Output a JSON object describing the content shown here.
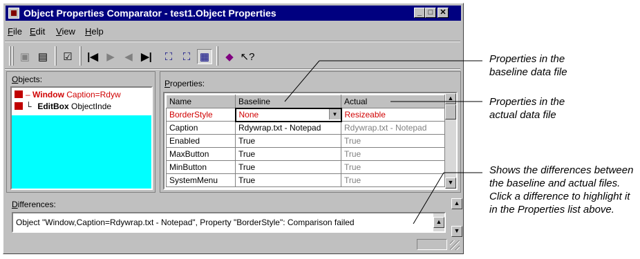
{
  "window": {
    "title": "Object Properties Comparator - test1.Object Properties",
    "controls": [
      "_",
      "□",
      "✕"
    ]
  },
  "menu": [
    {
      "label": "File",
      "accel": "F",
      "rest": "ile"
    },
    {
      "label": "Edit",
      "accel": "E",
      "rest": "dit"
    },
    {
      "label": "View",
      "accel": "V",
      "rest": "iew"
    },
    {
      "label": "Help",
      "accel": "H",
      "rest": "elp"
    }
  ],
  "toolbar": {
    "icons": [
      "save-baseline-icon",
      "save-icon",
      "properties-icon",
      "first-icon",
      "next-icon",
      "previous-icon",
      "last-icon",
      "compare-icon",
      "compare-selected-icon",
      "compare-all-icon",
      "help-book-icon",
      "whats-this-icon"
    ],
    "glyphs": [
      "▣",
      "▤",
      "☑",
      "|◀",
      "▶",
      "◀",
      "▶|",
      "⛶",
      "⛶",
      "▦",
      "◆",
      "↖?"
    ]
  },
  "objects": {
    "label_accel": "O",
    "label_rest": "bjects:",
    "items": [
      {
        "name": "Window",
        "detail": "Caption=Rdyw",
        "prefix": "–",
        "failed": true
      },
      {
        "name": "EditBox",
        "detail": "ObjectInde",
        "prefix": "└",
        "failed": false
      }
    ],
    "fill_color": "#00ffff"
  },
  "properties": {
    "label_accel": "P",
    "label_rest": "roperties:",
    "columns": [
      "Name",
      "Baseline",
      "Actual"
    ],
    "rows": [
      {
        "name": "BorderStyle",
        "baseline": "None",
        "actual": "Resizeable",
        "diff": true
      },
      {
        "name": "Caption",
        "baseline": "Rdywrap.txt - Notepad",
        "actual": "Rdywrap.txt - Notepad",
        "diff": false
      },
      {
        "name": "Enabled",
        "baseline": "True",
        "actual": "True",
        "diff": false
      },
      {
        "name": "MaxButton",
        "baseline": "True",
        "actual": "True",
        "diff": false
      },
      {
        "name": "MinButton",
        "baseline": "True",
        "actual": "True",
        "diff": false
      },
      {
        "name": "SystemMenu",
        "baseline": "True",
        "actual": "True",
        "diff": false
      }
    ]
  },
  "differences": {
    "label_accel": "D",
    "label_rest": "ifferences:",
    "text": "Object \"Window,Caption=Rdywrap.txt - Notepad\", Property \"BorderStyle\": Comparison failed"
  },
  "callouts": {
    "baseline": "Properties in the baseline data file",
    "actual": "Properties in the actual data file",
    "differences": "Shows the differences between the baseline and actual files. Click a difference to highlight it in the Properties list above."
  }
}
